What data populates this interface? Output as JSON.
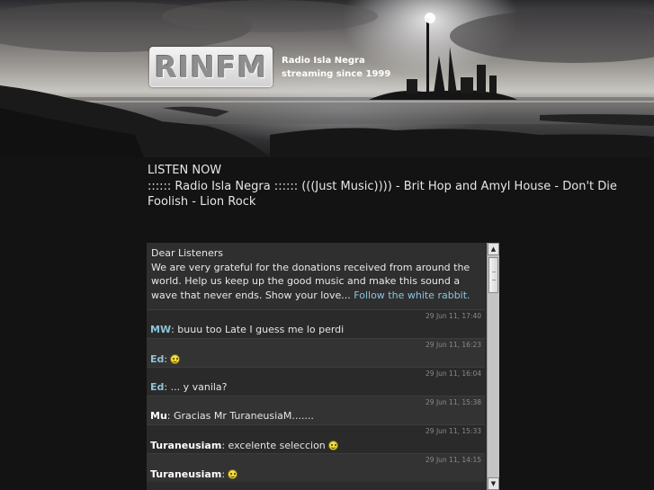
{
  "brand": {
    "logo": "RINFM",
    "tagline_line1": "Radio Isla Negra",
    "tagline_line2": "streaming since 1999"
  },
  "listen": {
    "heading": "LISTEN NOW",
    "now_playing": ":::::: Radio Isla Negra :::::: (((Just Music)))) - Brit Hop and Amyl House - Don't Die Foolish - Lion Rock"
  },
  "chat": {
    "notice": {
      "greeting": "Dear Listeners",
      "body": "We are very grateful for the donations received from around the world. Help us keep up the good music and make this sound a wave that never ends. Show your love...",
      "link": "Follow the white rabbit."
    },
    "messages": [
      {
        "time": "29 Jun 11, 17:40",
        "author": "MW",
        "separator": ":",
        "text": " buuu too Late I guess me lo perdi",
        "smiley": false
      },
      {
        "time": "29 Jun 11, 16:23",
        "author": "Ed",
        "separator": ":",
        "text": "",
        "smiley": true
      },
      {
        "time": "29 Jun 11, 16:04",
        "author": "Ed",
        "separator": ":",
        "text": " ... y vanila?",
        "smiley": false
      },
      {
        "time": "29 Jun 11, 15:38",
        "author": "Mu",
        "separator": ":",
        "text": " Gracias Mr TuraneusiaM.......",
        "smiley": false
      },
      {
        "time": "29 Jun 11, 15:33",
        "author": "Turaneusiam",
        "separator": ":",
        "text": " excelente seleccion",
        "smiley": true
      },
      {
        "time": "29 Jun 11, 14:15",
        "author": "Turaneusiam",
        "separator": ":",
        "text": "",
        "smiley": true
      }
    ],
    "scroll_up_glyph": "▲",
    "scroll_down_glyph": "▼"
  },
  "icons": {
    "smiley": "smiley-icon",
    "scroll_up": "arrow-up-icon",
    "scroll_down": "arrow-down-icon"
  },
  "colors": {
    "author_link": "#8fc3d9",
    "link": "#8bc4e0",
    "background": "#131313"
  }
}
